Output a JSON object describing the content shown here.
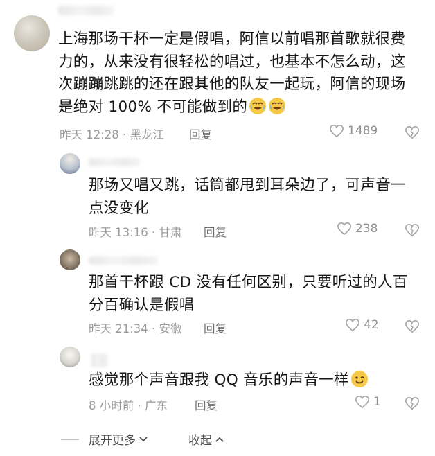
{
  "comments": [
    {
      "text_lines": [
        "上海那场干杯一定是假唱，阿信以前唱那首歌就很费",
        "力的，从来没有很轻松的唱过，也基本不怎么动，这",
        "次蹦蹦跳跳的还在跟其他的队友一起玩，阿信的现场",
        "是绝对 100% 不可能做到的"
      ],
      "emojis": [
        "crying-laughing-emoji",
        "crying-laughing-emoji"
      ],
      "time_location": "昨天 12:28 · 黑龙江",
      "reply_label": "回复",
      "likes": "1489"
    },
    {
      "text_lines": [
        "那场又唱又跳，话筒都甩到耳朵边了，可声音一",
        "点没变化"
      ],
      "time_location": "昨天 13:16 · 甘肃",
      "reply_label": "回复",
      "likes": "238"
    },
    {
      "text_lines": [
        "那首干杯跟 CD 没有任何区别，只要听过的人百",
        "分百确认是假唱"
      ],
      "time_location": "昨天 21:34 · 安徽",
      "reply_label": "回复",
      "likes": "42"
    },
    {
      "text_lines": [
        "感觉那个声音跟我 QQ 音乐的声音一样"
      ],
      "emojis": [
        "smiling-emoji"
      ],
      "time_location": "8 小时前 · 广东",
      "reply_label": "回复",
      "likes": "1"
    }
  ],
  "footer": {
    "expand_label": "展开更多",
    "collapse_label": "收起"
  },
  "colors": {
    "text": "#161616",
    "meta": "#9b9b9b",
    "icon": "#a3a3a3"
  }
}
